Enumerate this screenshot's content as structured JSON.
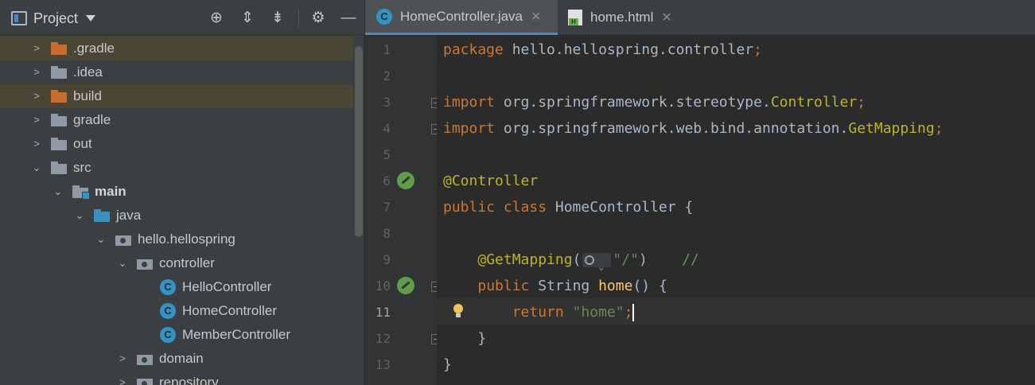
{
  "project_panel": {
    "title": "Project",
    "tree": [
      {
        "label": ".gradle",
        "expanded": false,
        "kind": "folder-excluded",
        "highlighted": true
      },
      {
        "label": ".idea",
        "expanded": false,
        "kind": "folder",
        "highlighted": false
      },
      {
        "label": "build",
        "expanded": false,
        "kind": "folder-excluded",
        "highlighted": true
      },
      {
        "label": "gradle",
        "expanded": false,
        "kind": "folder",
        "highlighted": false
      },
      {
        "label": "out",
        "expanded": false,
        "kind": "folder",
        "highlighted": false
      },
      {
        "label": "src",
        "expanded": true,
        "kind": "folder",
        "highlighted": false
      },
      {
        "label": "main",
        "expanded": true,
        "kind": "module-folder",
        "highlighted": false
      },
      {
        "label": "java",
        "expanded": true,
        "kind": "source-folder",
        "highlighted": false
      },
      {
        "label": "hello.hellospring",
        "expanded": true,
        "kind": "package",
        "highlighted": false
      },
      {
        "label": "controller",
        "expanded": true,
        "kind": "package",
        "highlighted": false
      },
      {
        "label": "HelloController",
        "kind": "class",
        "icon_letter": "C"
      },
      {
        "label": "HomeController",
        "kind": "class",
        "icon_letter": "C"
      },
      {
        "label": "MemberController",
        "kind": "class",
        "icon_letter": "C"
      },
      {
        "label": "domain",
        "expanded": false,
        "kind": "package",
        "highlighted": false
      },
      {
        "label": "repository",
        "expanded": false,
        "kind": "package",
        "highlighted": false
      }
    ]
  },
  "tabs": [
    {
      "label": "HomeController.java",
      "icon": "class-icon",
      "icon_letter": "C",
      "active": true,
      "close": "✕"
    },
    {
      "label": "home.html",
      "icon": "html-file-icon",
      "active": false,
      "close": "✕"
    }
  ],
  "editor": {
    "current_line": 11,
    "line_numbers": [
      "1",
      "2",
      "3",
      "4",
      "5",
      "6",
      "7",
      "8",
      "9",
      "10",
      "11",
      "12",
      "13"
    ],
    "code": {
      "l1_kw": "package",
      "l1_rest": " hello.hellospring.controller",
      "l1_semi": ";",
      "l3_kw": "import",
      "l3_rest": " org.springframework.stereotype.",
      "l3_cls": "Controller",
      "l3_semi": ";",
      "l4_kw": "import",
      "l4_rest": " org.springframework.web.bind.annotation.",
      "l4_cls": "GetMapping",
      "l4_semi": ";",
      "l6_ann": "@Controller",
      "l7_kw": "public class",
      "l7_rest": " HomeController {",
      "l9_indent": "    ",
      "l9_ann": "@GetMapping",
      "l9_open": "(",
      "l9_str": "\"/\"",
      "l9_close": ")",
      "l9_cmt": "    //",
      "l10_indent": "    ",
      "l10_kw": "public",
      "l10_type": " String ",
      "l10_fn": "home",
      "l10_rest": "() {",
      "l11_indent": "        ",
      "l11_kw": "return",
      "l11_sp": " ",
      "l11_str": "\"home\"",
      "l11_semi": ";",
      "l12_text": "    }",
      "l13_text": "}"
    }
  },
  "colors": {
    "keyword": "#cc7832",
    "annotation": "#bbb529",
    "string": "#6a8759",
    "function": "#ffc66d",
    "comment": "#629755",
    "text": "#a9b7c6",
    "accent": "#4a88c7",
    "excluded_folder": "#c96d2e",
    "class_icon": "#3592c4"
  }
}
